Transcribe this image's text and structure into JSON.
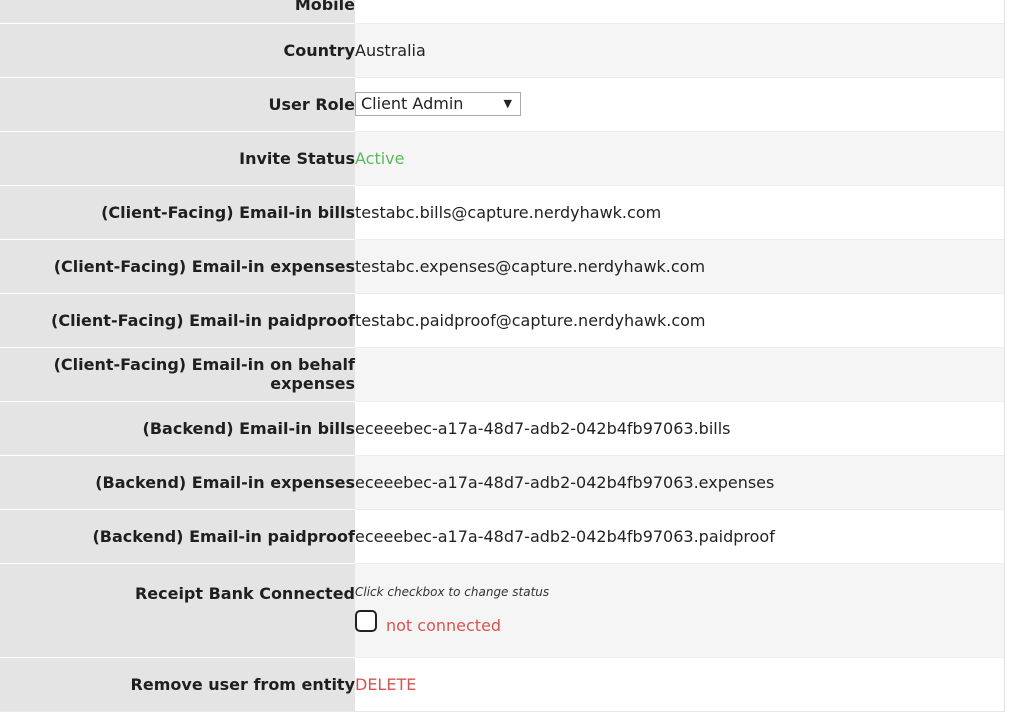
{
  "rows": {
    "mobile": {
      "label": "Mobile",
      "value": ""
    },
    "country": {
      "label": "Country",
      "value": "Australia"
    },
    "user_role": {
      "label": "User Role",
      "selected": "Client Admin"
    },
    "invite_status": {
      "label": "Invite Status",
      "value": "Active"
    },
    "cf_bills": {
      "label": "(Client-Facing) Email-in bills",
      "value": "testabc.bills@capture.nerdyhawk.com"
    },
    "cf_expenses": {
      "label": "(Client-Facing) Email-in expenses",
      "value": "testabc.expenses@capture.nerdyhawk.com"
    },
    "cf_paidproof": {
      "label": "(Client-Facing) Email-in paidproof",
      "value": "testabc.paidproof@capture.nerdyhawk.com"
    },
    "cf_behalf": {
      "label": "(Client-Facing) Email-in on behalf expenses",
      "value": ""
    },
    "be_bills": {
      "label": "(Backend) Email-in bills",
      "value": "eceeebec-a17a-48d7-adb2-042b4fb97063.bills"
    },
    "be_expenses": {
      "label": "(Backend) Email-in expenses",
      "value": "eceeebec-a17a-48d7-adb2-042b4fb97063.expenses"
    },
    "be_paidproof": {
      "label": "(Backend) Email-in paidproof",
      "value": "eceeebec-a17a-48d7-adb2-042b4fb97063.paidproof"
    },
    "receipt_bank": {
      "label": "Receipt Bank Connected",
      "hint": "Click checkbox to change status",
      "checked": false,
      "status": "not connected"
    },
    "remove_user": {
      "label": "Remove user from entity",
      "action": "DELETE"
    }
  },
  "colors": {
    "active": "#5cb85c",
    "danger": "#d9534f",
    "label_bg": "#e4e4e4",
    "odd_row_bg": "#f5f5f5"
  }
}
